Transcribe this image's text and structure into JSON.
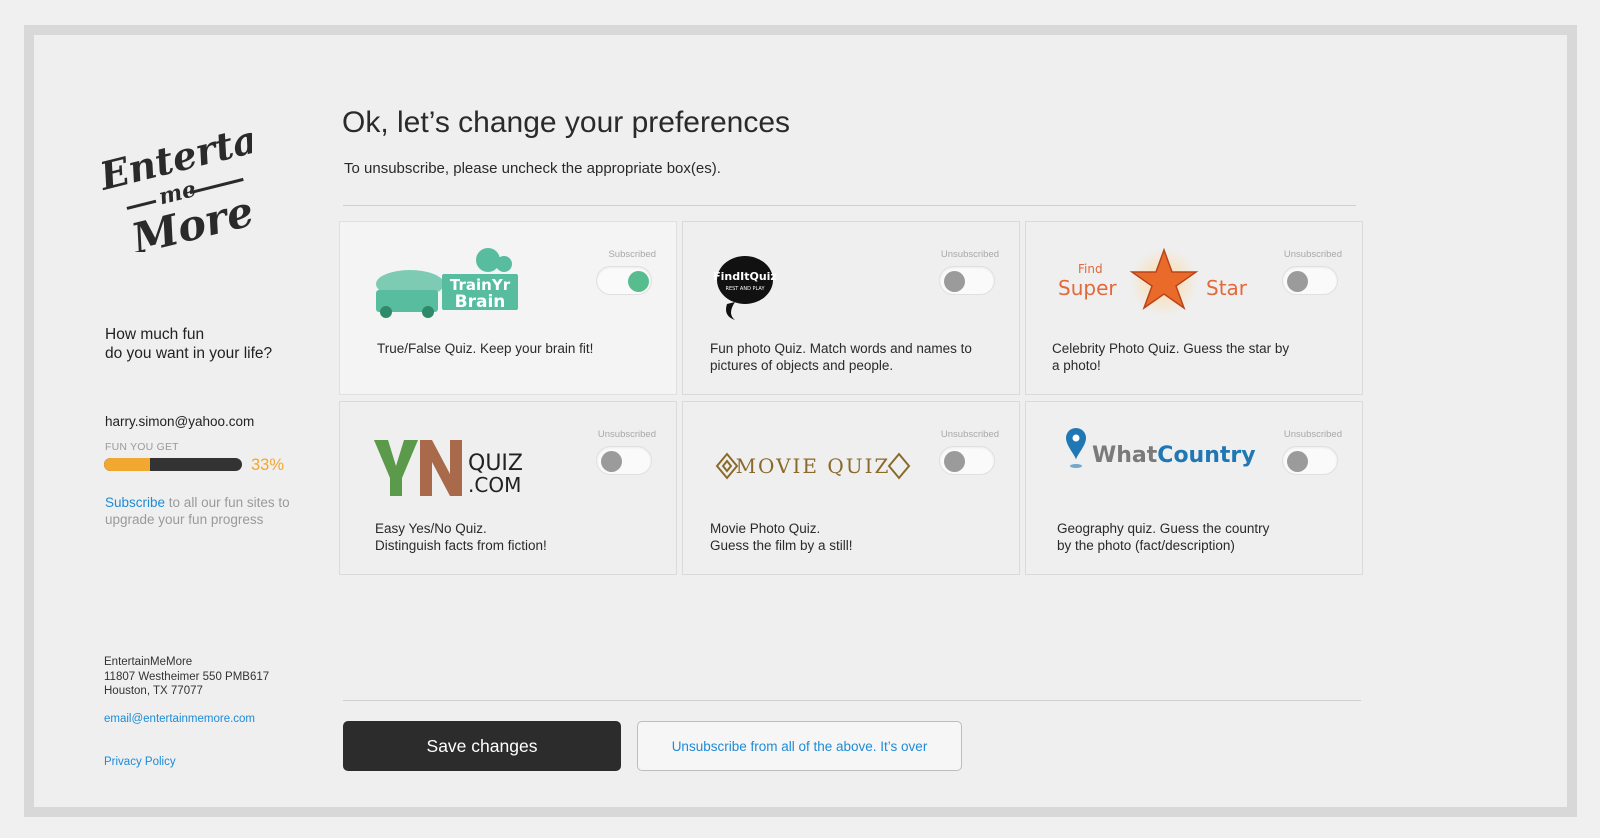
{
  "brand": {
    "logo_line1": "Entertain",
    "logo_line2": "me",
    "logo_line3": "More"
  },
  "sidebar": {
    "tagline_line1": "How much fun",
    "tagline_line2": "do you want in your life?",
    "user_email": "harry.simon@yahoo.com",
    "fun_label": "FUN YOU GET",
    "fun_progress": 33,
    "fun_progress_text": "33%",
    "subscribe_link": "Subscribe",
    "subscribe_rest": " to all our fun sites to upgrade your fun progress",
    "address_name": "EntertainMeMore",
    "address_street": "11807 Westheimer 550 PMB617",
    "address_city": "Houston, TX 77077",
    "contact_email": "email@entertainmemore.com",
    "privacy_link": "Privacy Policy"
  },
  "main": {
    "title": "Ok, let’s change your preferences",
    "subtitle": "To unsubscribe, please uncheck the appropriate box(es).",
    "save_label": "Save changes",
    "unsubscribe_all_label": "Unsubscribe from all of the above. It’s over"
  },
  "cards": [
    {
      "name": "TrainYrBrain",
      "logo_text_1": "TrainYr",
      "logo_text_2": "Brain",
      "status": "Subscribed",
      "subscribed": true,
      "desc_1": "True/False Quiz. Keep your brain fit!",
      "desc_2": "",
      "logo_color": "#57bd9e"
    },
    {
      "name": "FindItQuiz",
      "logo_text_1": "FindItQuiz",
      "logo_text_2": "REST AND PLAY",
      "status": "Unsubscribed",
      "subscribed": false,
      "desc_1": "Fun photo Quiz. Match words and names to",
      "desc_2": "pictures of objects and people.",
      "logo_color": "#111111"
    },
    {
      "name": "FindSuperStar",
      "logo_text_1": "Find",
      "logo_text_2": "Super",
      "logo_text_3": "Star",
      "status": "Unsubscribed",
      "subscribed": false,
      "desc_1": "Celebrity Photo Quiz. Guess the star by",
      "desc_2": "a photo!",
      "logo_color": "#e3683a"
    },
    {
      "name": "YNQuiz",
      "logo_text_1": "QUIZ",
      "logo_text_2": ".COM",
      "status": "Unsubscribed",
      "subscribed": false,
      "desc_1": "Easy Yes/No Quiz.",
      "desc_2": "Distinguish facts from fiction!",
      "logo_color": "#5a9a4a"
    },
    {
      "name": "MovieQuiz",
      "logo_text_1": "MOVIE QUIZ",
      "logo_text_2": "",
      "status": "Unsubscribed",
      "subscribed": false,
      "desc_1": "Movie Photo Quiz.",
      "desc_2": "Guess the film by a still!",
      "logo_color": "#8a6a2a"
    },
    {
      "name": "WhatCountry",
      "logo_text_1": "What",
      "logo_text_2": "Country",
      "status": "Unsubscribed",
      "subscribed": false,
      "desc_1": "Geography quiz. Guess the country",
      "desc_2": "by the photo (fact/description)",
      "logo_color": "#1f77b4"
    }
  ],
  "colors": {
    "accent": "#f0a830",
    "link": "#1e8bd6",
    "toggle_on": "#57bd8e",
    "toggle_off": "#9b9b9b",
    "button_dark": "#2c2c2c"
  },
  "icons": [
    "entertainmemore-logo",
    "trainyrbrain-logo",
    "finditquiz-logo",
    "findsuperstar-logo",
    "ynquiz-logo",
    "moviequiz-logo",
    "whatcountry-logo",
    "location-pin-icon",
    "star-icon"
  ]
}
